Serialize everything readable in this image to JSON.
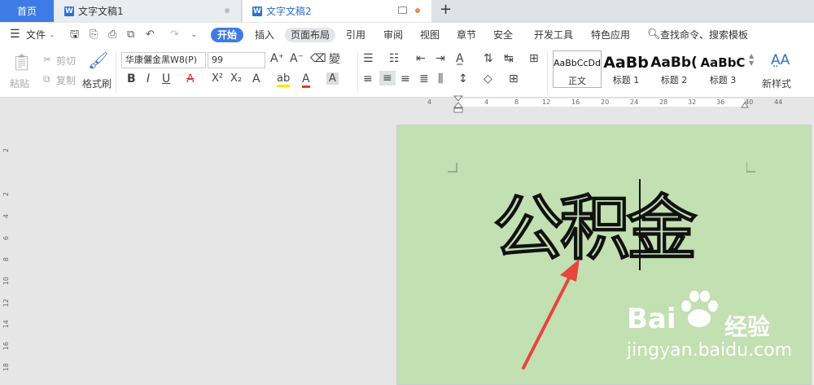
{
  "tabs": {
    "home": "首页",
    "doc1": "文字文稿1",
    "doc2": "文字文稿2",
    "new_tab": "+"
  },
  "menu": {
    "file": "文件",
    "items": [
      "开始",
      "插入",
      "页面布局",
      "引用",
      "审阅",
      "视图",
      "章节",
      "安全",
      "开发工具",
      "特色应用"
    ],
    "search": "查找命令、搜索模板"
  },
  "ribbon": {
    "paste": "粘贴",
    "cut": "剪切",
    "copy": "复制",
    "format_painter": "格式刷",
    "font_name": "华康儷金黑W8(P)",
    "font_size": "99",
    "styles": [
      {
        "preview": "AaBbCcDd",
        "label": "正文"
      },
      {
        "preview": "AaBb",
        "label": "标题 1"
      },
      {
        "preview": "AaBb(",
        "label": "标题 2"
      },
      {
        "preview": "AaBbC",
        "label": "标题 3"
      }
    ],
    "new_style": "新样式"
  },
  "ruler": {
    "ticks": [
      "4",
      "4",
      "8",
      "12",
      "16",
      "20",
      "24",
      "28",
      "32",
      "36",
      "40",
      "44"
    ],
    "vticks": [
      "2",
      "2",
      "4",
      "6",
      "8",
      "10",
      "12",
      "14",
      "16",
      "18"
    ]
  },
  "document": {
    "text": "公积金"
  },
  "watermark": {
    "brand_prefix": "Bai",
    "brand_suffix": "经验",
    "url": "jingyan.baidu.com"
  },
  "colors": {
    "accent": "#3e7be6",
    "page_bg": "#c2e0b1",
    "arrow": "#e8453c"
  }
}
